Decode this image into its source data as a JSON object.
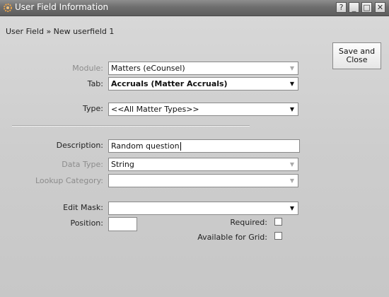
{
  "window": {
    "title": "User Field Information",
    "buttons": {
      "help": "?",
      "minimize": "_",
      "maximize": "□",
      "close": "✕"
    }
  },
  "breadcrumb": "User Field » New userfield 1",
  "save_button": "Save and\nClose",
  "form": {
    "module": {
      "label": "Module:",
      "value": "Matters (eCounsel)"
    },
    "tab": {
      "label": "Tab:",
      "value": "Accruals (Matter Accruals)"
    },
    "type": {
      "label": "Type:",
      "value": "<<All Matter Types>>"
    },
    "description": {
      "label": "Description:",
      "value": "Random question"
    },
    "data_type": {
      "label": "Data Type:",
      "value": "String"
    },
    "lookup_category": {
      "label": "Lookup Category:",
      "value": ""
    },
    "edit_mask": {
      "label": "Edit Mask:",
      "value": ""
    },
    "position": {
      "label": "Position:",
      "value": ""
    },
    "required": {
      "label": "Required:",
      "checked": false
    },
    "available_for_grid": {
      "label": "Available for Grid:",
      "checked": false
    }
  },
  "icons": {
    "app": "gear-icon",
    "dropdown": "chevron-down-icon"
  },
  "colors": {
    "titlebar": "#6e6e6e",
    "title_text": "#ffffff",
    "disabled_label": "#8c8c8c"
  }
}
